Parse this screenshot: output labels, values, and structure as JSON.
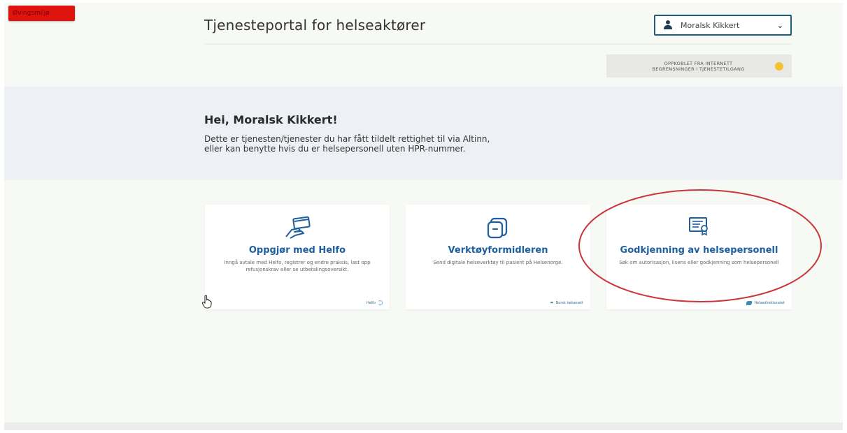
{
  "env_badge": "Øvingsmiljø",
  "header": {
    "title": "Tjenesteportal for helseaktører",
    "user_name": "Moralsk Kikkert"
  },
  "notice": {
    "line1": "OPPKOBLET FRA INTERNETT",
    "line2": "BEGRENSNINGER I TJENESTETILGANG"
  },
  "hero": {
    "greeting": "Hei, Moralsk Kikkert!",
    "description_line1": "Dette er tjenesten/tjenester du har fått tildelt rettighet til via Altinn,",
    "description_line2": "eller kan benytte hvis du er helsepersonell uten HPR-nummer."
  },
  "cards": [
    {
      "title": "Oppgjør med Helfo",
      "description": "Inngå avtale med Helfo, registrer og endre praksis, last opp refusjonskrav eller se utbetalingsoversikt.",
      "logo_text": "Helfo",
      "icon": "card-payment-icon"
    },
    {
      "title": "Verktøyformidleren",
      "description": "Send digitale helseverktøy til pasient på Helsenorge.",
      "logo_text": "Norsk helsenett",
      "icon": "chat-bubbles-icon"
    },
    {
      "title": "Godkjenning av helsepersonell",
      "description": "Søk om autorisasjon, lisens eller godkjenning som helsepersonell",
      "logo_text": "Helsedirektoratet",
      "icon": "certificate-icon"
    }
  ],
  "colors": {
    "accent_blue": "#1f5fa0",
    "highlight_red": "#c9363b",
    "badge_red": "#e0140f",
    "hero_bg": "#edf1f5"
  }
}
